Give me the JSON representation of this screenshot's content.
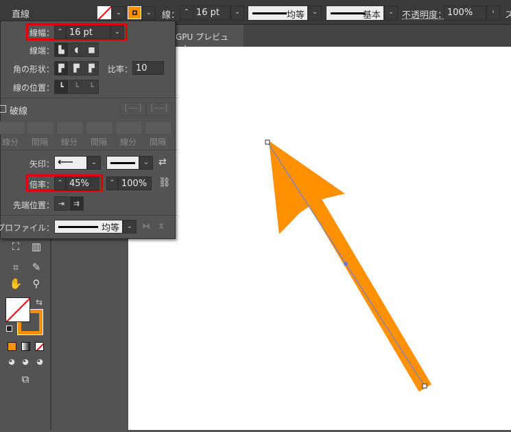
{
  "control_bar": {
    "object_type": "直線",
    "stroke_label": "線：",
    "stroke_weight": "16 pt",
    "profile": "均等",
    "brush": "基本",
    "opacity_label": "不透明度：",
    "opacity": "100%",
    "more": "ス"
  },
  "document_tab": {
    "label": "GPU プレビュー)"
  },
  "stroke_panel": {
    "weight_label": "線幅：",
    "weight": "16 pt",
    "cap_label": "線端：",
    "corner_label": "角の形状：",
    "limit_label": "比率：",
    "limit": "10",
    "align_label": "線の位置：",
    "dashed_label": "破線",
    "dashed_checked": false,
    "dash_fields": [
      "線分",
      "間隔",
      "線分",
      "間隔",
      "線分",
      "間隔"
    ],
    "arrow_label": "矢印：",
    "arrow_start": "arrow-left",
    "arrow_end": "none",
    "scale_label": "倍率：",
    "scale_start": "45%",
    "scale_end": "100%",
    "align_tip_label": "先端位置：",
    "profile_label": "プロファイル：",
    "profile": "均等"
  },
  "colors": {
    "stroke": "#ff9000",
    "highlight": "#e00000",
    "path": "#5b7bf0"
  }
}
